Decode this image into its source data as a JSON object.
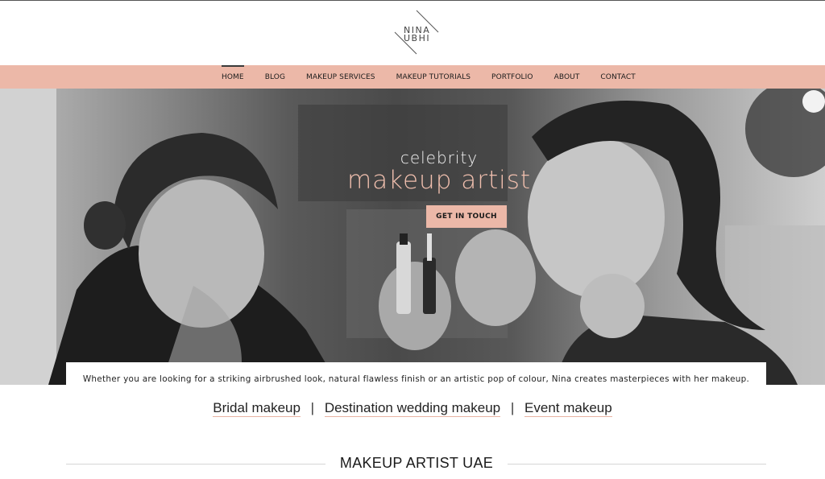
{
  "brand": {
    "logo_line1": "NINA",
    "logo_line2": "UBHI"
  },
  "nav": {
    "items": [
      {
        "label": "HOME",
        "active": true
      },
      {
        "label": "BLOG"
      },
      {
        "label": "MAKEUP SERVICES"
      },
      {
        "label": "MAKEUP TUTORIALS"
      },
      {
        "label": "PORTFOLIO"
      },
      {
        "label": "ABOUT"
      },
      {
        "label": "CONTACT"
      }
    ]
  },
  "hero": {
    "subtitle": "celebrity",
    "title": "makeup artist",
    "cta_label": "GET IN TOUCH"
  },
  "intro": {
    "text": "Whether you are looking for a striking airbrushed look, natural flawless finish or an artistic pop of colour, Nina creates masterpieces with her makeup."
  },
  "services": {
    "items": [
      "Bridal makeup",
      "Destination wedding makeup",
      "Event makeup"
    ],
    "separator": "|"
  },
  "section": {
    "heading": "MAKEUP ARTIST UAE"
  },
  "colors": {
    "accent": "#ecb8a8",
    "hero_title": "#f0bfae"
  }
}
